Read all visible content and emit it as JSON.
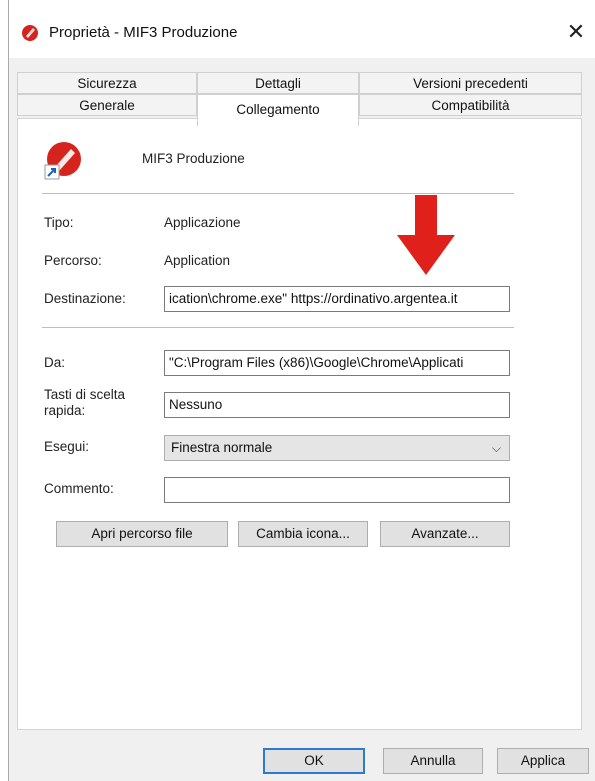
{
  "window": {
    "title": "Proprietà - MIF3 Produzione",
    "close_glyph": "✕"
  },
  "tabs": {
    "row1": [
      "Sicurezza",
      "Dettagli",
      "Versioni precedenti"
    ],
    "row2": [
      "Generale",
      "Collegamento",
      "Compatibilità"
    ],
    "active": "Collegamento"
  },
  "shortcut": {
    "name": "MIF3 Produzione",
    "icon": "chrome-app-shortcut-icon",
    "tipo_label": "Tipo:",
    "tipo_value": "Applicazione",
    "percorso_label": "Percorso:",
    "percorso_value": "Application",
    "destinazione_label": "Destinazione:",
    "destinazione_value": "ication\\chrome.exe\" https://ordinativo.argentea.it",
    "da_label": "Da:",
    "da_value": "\"C:\\Program Files (x86)\\Google\\Chrome\\Applicati",
    "tasti_label": "Tasti di scelta rapida:",
    "tasti_value": "Nessuno",
    "esegui_label": "Esegui:",
    "esegui_value": "Finestra normale",
    "commento_label": "Commento:",
    "commento_value": ""
  },
  "buttons": {
    "apri": "Apri percorso file",
    "cambia": "Cambia icona...",
    "avanzate": "Avanzate...",
    "ok": "OK",
    "annulla": "Annulla",
    "applica": "Applica"
  },
  "colors": {
    "arrow": "#e0201b",
    "focus_border": "#2f7ad1"
  }
}
